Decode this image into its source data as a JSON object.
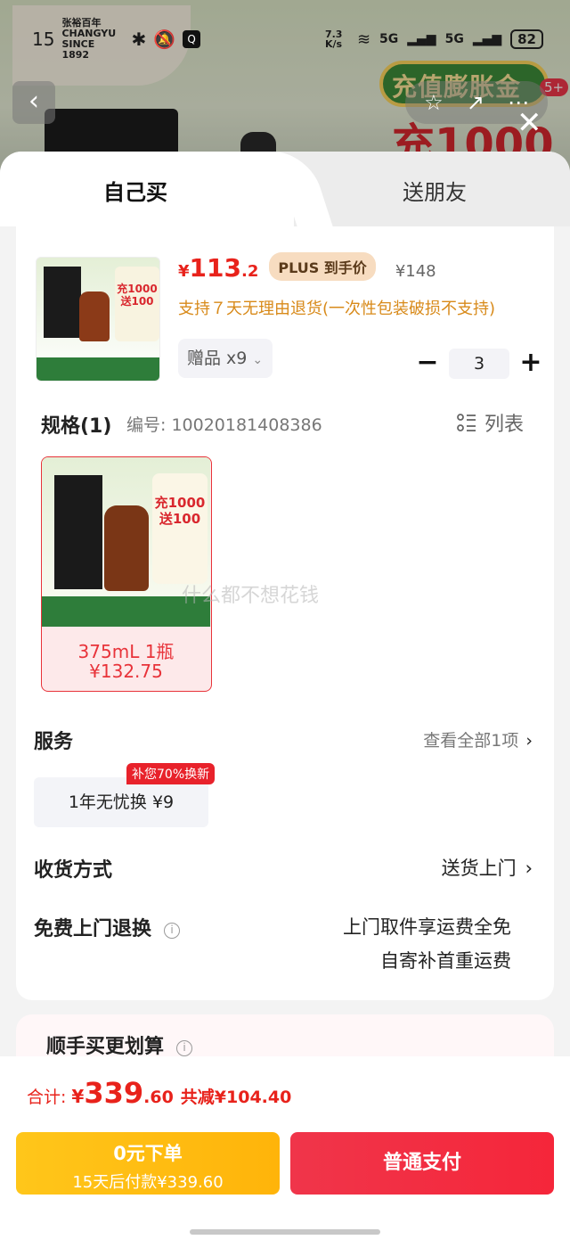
{
  "status_bar": {
    "time": "15",
    "net_speed": "7.3 K/s",
    "signal1": "5G",
    "signal2": "5G",
    "battery": "82"
  },
  "background": {
    "brand_text": "张裕百年 CHANGYU SINCE 1892",
    "promo_title": "充值膨胀金",
    "promo_big": "充1000",
    "notif_badge": "5+"
  },
  "tabs": [
    {
      "label": "自己买"
    },
    {
      "label": "送朋友"
    }
  ],
  "product": {
    "price_currency": "¥",
    "price_int": "113",
    "price_dec": ".2",
    "plus_label": "PLUS 到手价",
    "orig_price": "¥148",
    "return_note": "支持７天无理由退货(一次性包装破损不支持)",
    "gift_label": "赠品 x9",
    "quantity": "3",
    "thumb_promo": "充1000 送100"
  },
  "spec": {
    "title": "规格(1)",
    "code_label": "编号: 10020181408386",
    "list_label": "列表",
    "option_name": "375mL 1瓶",
    "option_price": "¥132.75",
    "promo_text": "充1000 送100",
    "watermark": "什么都不想花钱"
  },
  "service": {
    "title": "服务",
    "view_all": "查看全部1项",
    "option": "1年无忧换  ¥9",
    "tag": "补您70%换新"
  },
  "delivery": {
    "title": "收货方式",
    "value": "送货上门"
  },
  "free_return": {
    "title": "免费上门退换",
    "line1": "上门取件享运费全免",
    "line2": "自寄补首重运费"
  },
  "combo": {
    "title": "顺手买更划算"
  },
  "footer": {
    "total_label": "合计:",
    "total_currency": "¥",
    "total_int": "339",
    "total_dec": ".60",
    "total_save": "共减¥104.40",
    "later_line1": "0元下单",
    "later_line2": "15天后付款¥339.60",
    "pay_label": "普通支付"
  },
  "colors": {
    "accent_red": "#e8221b",
    "pay_button": "#f0354a",
    "later_button": "#ffc61a",
    "plus_badge": "#f7dcc0"
  }
}
